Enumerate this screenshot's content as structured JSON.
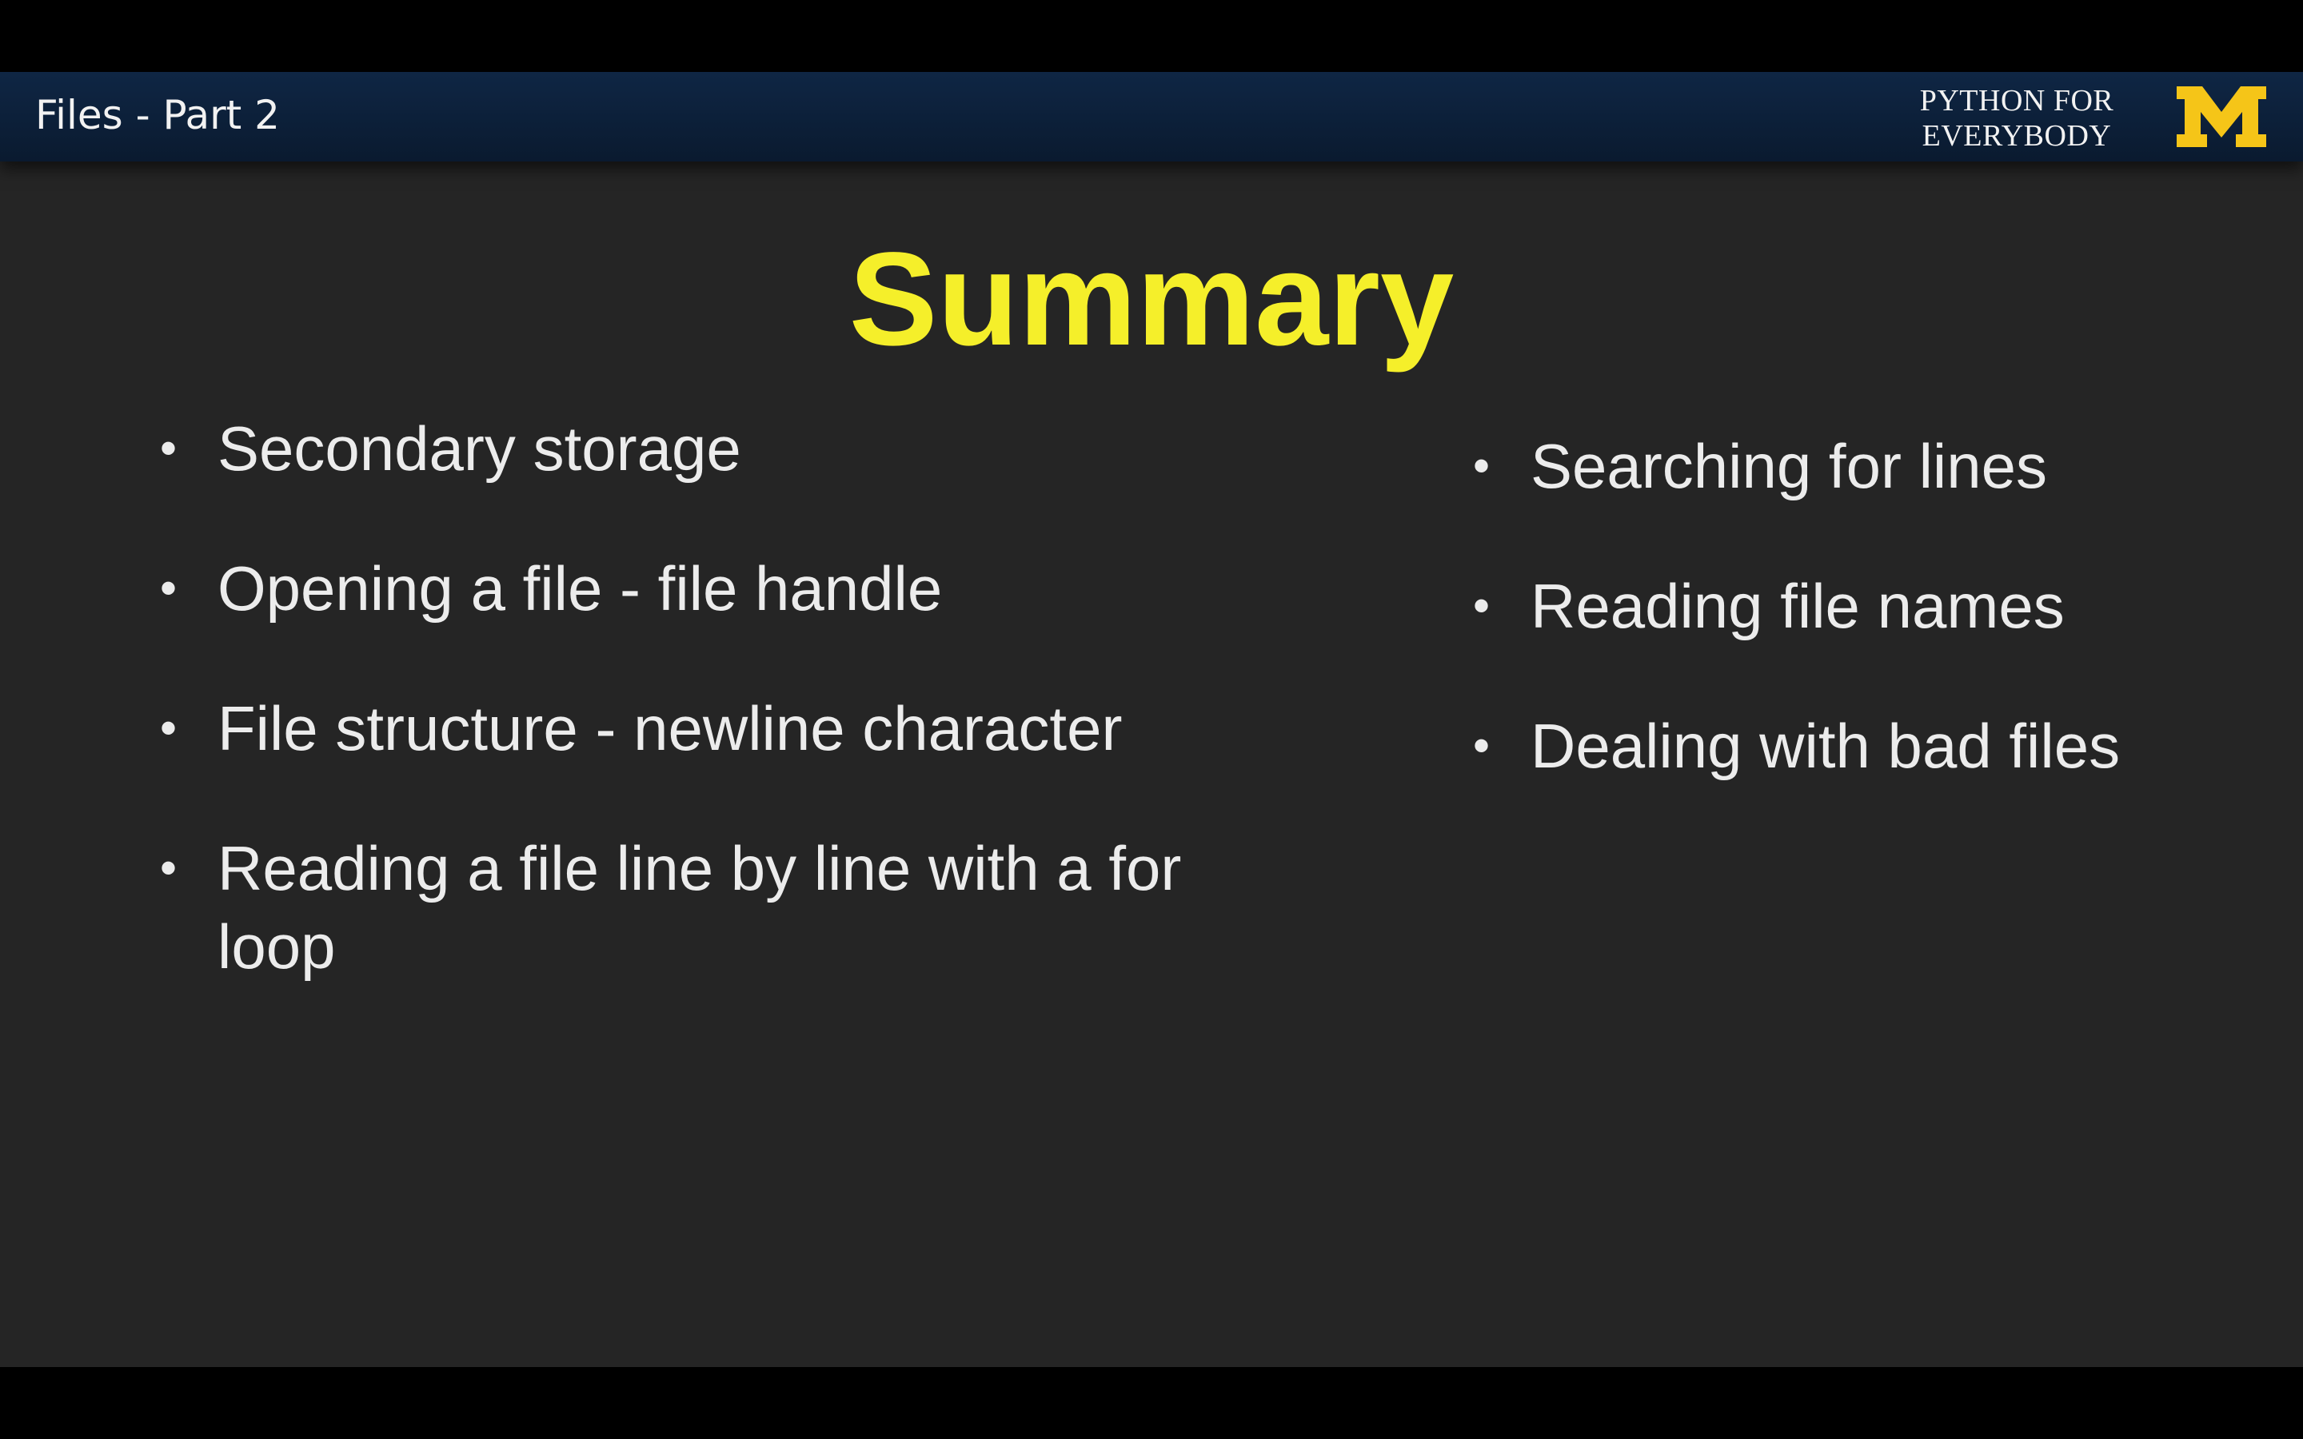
{
  "header": {
    "title": "Files - Part 2",
    "brand_line1": "PYTHON FOR",
    "brand_line2": "EVERYBODY",
    "logo_icon": "block-m-icon",
    "background_color": "#0d223d",
    "logo_color": "#f5c518"
  },
  "slide": {
    "title": "Summary",
    "title_color": "#f5ef2a",
    "background_color": "#252525",
    "bullet_glyph": "•",
    "left_bullets": [
      "Secondary storage",
      "Opening a file - file handle",
      "File structure - newline character",
      "Reading a file line by line with a for loop"
    ],
    "right_bullets": [
      "Searching for lines",
      "Reading file names",
      "Dealing with bad files"
    ]
  }
}
